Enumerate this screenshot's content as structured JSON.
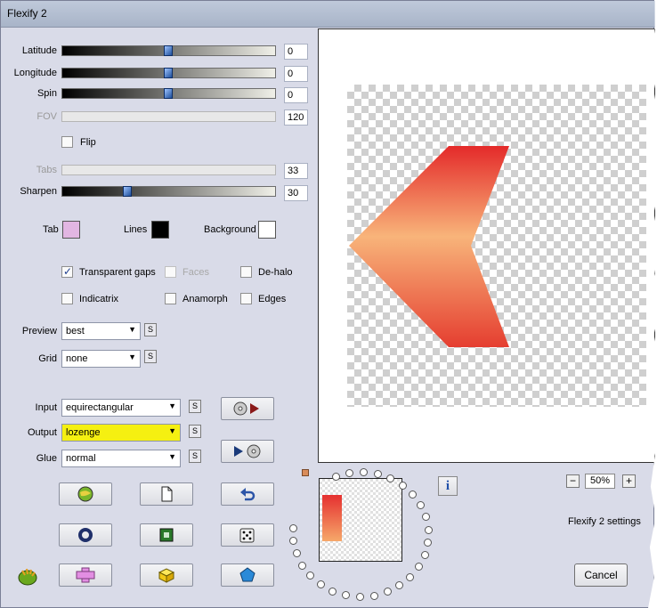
{
  "window": {
    "title": "Flexify 2"
  },
  "sliders": [
    {
      "label": "Latitude",
      "value": "0",
      "level": 0.5,
      "enabled": true
    },
    {
      "label": "Longitude",
      "value": "0",
      "level": 0.5,
      "enabled": true
    },
    {
      "label": "Spin",
      "value": "0",
      "level": 0.5,
      "enabled": true
    },
    {
      "label": "FOV",
      "value": "120",
      "enabled": false
    },
    {
      "label": "Tabs",
      "value": "33",
      "enabled": false
    },
    {
      "label": "Sharpen",
      "value": "30",
      "level": 0.3,
      "enabled": true
    }
  ],
  "flip": {
    "label": "Flip",
    "checked": false
  },
  "swatches": {
    "tab": {
      "label": "Tab",
      "color": "#e2b6e2"
    },
    "lines": {
      "label": "Lines",
      "color": "#000000"
    },
    "background": {
      "label": "Background",
      "color": "#ffffff"
    }
  },
  "checks": {
    "transparent_gaps": {
      "label": "Transparent gaps",
      "checked": true
    },
    "faces": {
      "label": "Faces",
      "checked": false,
      "enabled": false
    },
    "dehalo": {
      "label": "De-halo",
      "checked": false
    },
    "indicatrix": {
      "label": "Indicatrix",
      "checked": false
    },
    "anamorph": {
      "label": "Anamorph",
      "checked": false
    },
    "edges": {
      "label": "Edges",
      "checked": false
    }
  },
  "selects": {
    "preview": {
      "label": "Preview",
      "value": "best"
    },
    "grid": {
      "label": "Grid",
      "value": "none"
    },
    "input": {
      "label": "Input",
      "value": "equirectangular"
    },
    "output": {
      "label": "Output",
      "value": "lozenge",
      "highlight": "#f5f011"
    },
    "glue": {
      "label": "Glue",
      "value": "normal"
    }
  },
  "s_button_label": "S",
  "zoom": {
    "value": "50%",
    "minus": "−",
    "plus": "+"
  },
  "settings_text": "Flexify 2 settings",
  "cancel_label": "Cancel",
  "info_label": "i",
  "colors": {
    "shape_top": "#e42a2a",
    "shape_bottom": "#f8b47a"
  }
}
